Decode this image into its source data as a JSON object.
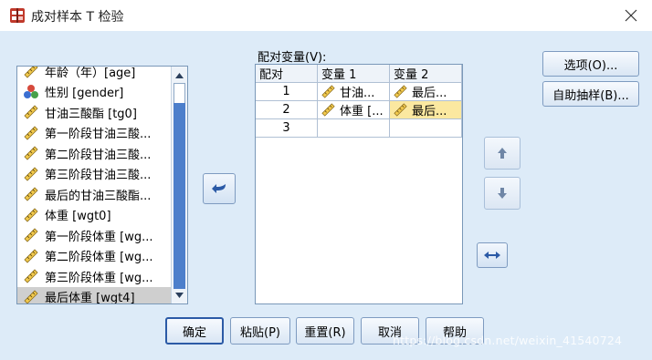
{
  "window": {
    "title": "成对样本 T 检验",
    "close_glyph": "✕"
  },
  "variables": {
    "items": [
      {
        "label": "年龄（年）[age]",
        "icon": "scale-ruler-icon"
      },
      {
        "label": "性别 [gender]",
        "icon": "nominal-balls-icon"
      },
      {
        "label": "甘油三酸酯 [tg0]",
        "icon": "scale-ruler-icon"
      },
      {
        "label": "第一阶段甘油三酸...",
        "icon": "scale-ruler-icon"
      },
      {
        "label": "第二阶段甘油三酸...",
        "icon": "scale-ruler-icon"
      },
      {
        "label": "第三阶段甘油三酸...",
        "icon": "scale-ruler-icon"
      },
      {
        "label": "最后的甘油三酸酯...",
        "icon": "scale-ruler-icon"
      },
      {
        "label": "体重 [wgt0]",
        "icon": "scale-ruler-icon"
      },
      {
        "label": "第一阶段体重 [wg...",
        "icon": "scale-ruler-icon"
      },
      {
        "label": "第二阶段体重 [wg...",
        "icon": "scale-ruler-icon"
      },
      {
        "label": "第三阶段体重 [wg...",
        "icon": "scale-ruler-icon"
      },
      {
        "label": "最后体重 [wgt4]",
        "icon": "scale-ruler-icon",
        "selected": true
      }
    ]
  },
  "pairs": {
    "label": "配对变量(V):",
    "headers": {
      "pair": "配对",
      "var1": "变量 1",
      "var2": "变量 2"
    },
    "rows": [
      {
        "pair": "1",
        "var1": "甘油...",
        "var2": "最后..."
      },
      {
        "pair": "2",
        "var1": "体重 [...",
        "var2": "最后..."
      },
      {
        "pair": "3",
        "var1": "",
        "var2": ""
      }
    ]
  },
  "right_buttons": {
    "options": "选项(O)...",
    "bootstrap": "自助抽样(B)..."
  },
  "bottom_buttons": {
    "ok": "确定",
    "paste": "粘贴(P)",
    "reset": "重置(R)",
    "cancel": "取消",
    "help": "帮助"
  },
  "watermark": "https://blog.csdn.net/weixin_41540724",
  "colors": {
    "client_bg": "#ddebf8",
    "accent_blue": "#2b5aa6",
    "highlight_yellow": "#fbe8a0",
    "selection_gray": "#cfcfcf"
  }
}
